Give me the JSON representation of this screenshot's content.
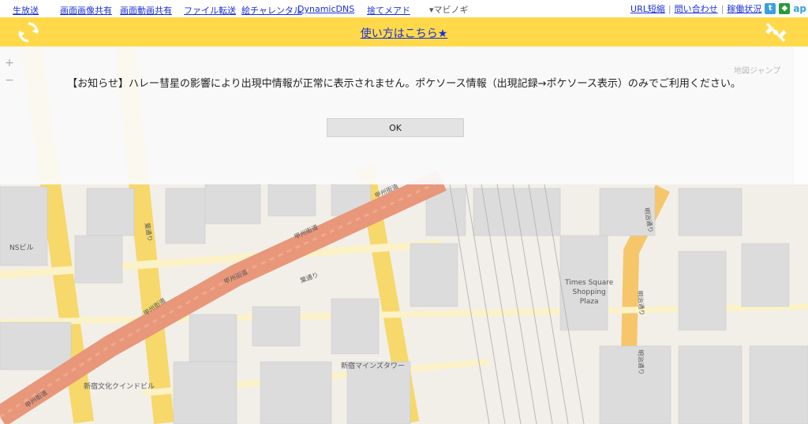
{
  "topbar": {
    "links": [
      "生放送",
      "画面画像共有",
      "画面動画共有",
      "ファイル転送",
      "絵チャレンタル",
      "DynamicDNS",
      "捨てメアド"
    ],
    "dropdown": "▾マビノギ",
    "right_links": [
      "URL短縮",
      "問い合わせ",
      "稼働状況"
    ],
    "separator": "|",
    "ap_label": "ap"
  },
  "header": {
    "howto": "使い方はこちら★"
  },
  "notice": {
    "message": "【お知らせ】ハレー彗星の影響により出現中情報が正常に表示されません。ポケソース情報（出現記録→ポケソース表示）のみでご利用ください。",
    "ok_label": "OK"
  },
  "map": {
    "zoom_in": "+",
    "zoom_out": "−",
    "jump_label": "地図ジャンプ",
    "labels": {
      "ns_building": "NSビル",
      "koshu1": "甲州街道",
      "koshu2": "甲州街道",
      "koshu3": "甲州街道",
      "koshu4": "甲州街道",
      "koshu5": "甲州街道",
      "times_square": "Times Square\nShopping\nPlaza",
      "mynd_tower": "新宿マインズタワー",
      "bunka": "新宿文化クインドビル",
      "meiji1": "明治通り",
      "meiji2": "明治通り",
      "meiji3": "明治通り",
      "hamon": "葉通り",
      "hamon2": "葉通り"
    }
  },
  "colors": {
    "header_bg": "#ffd94a",
    "link": "#1a2fd8",
    "major_road": "#e8977a",
    "yellow_road": "#f6d86b",
    "block": "#dcdcdc"
  }
}
